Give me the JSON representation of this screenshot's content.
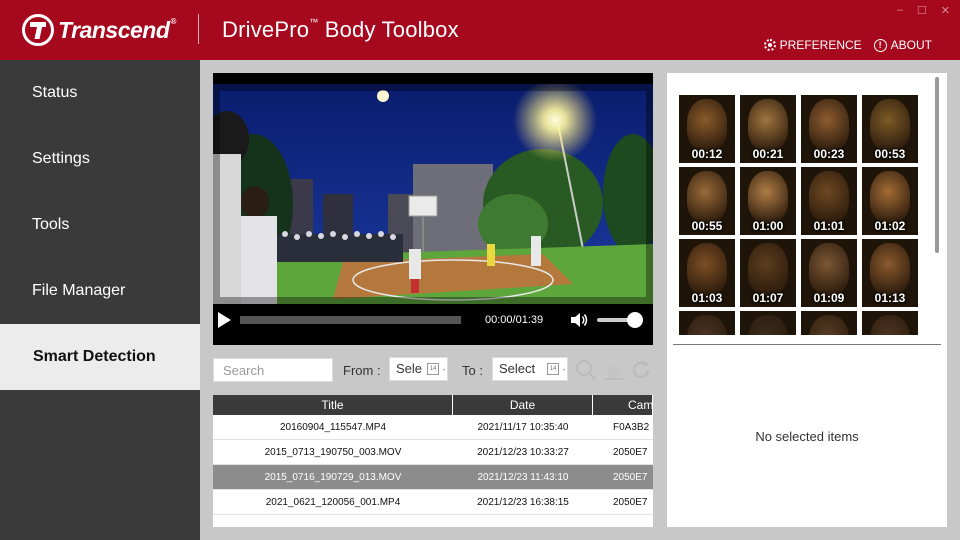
{
  "header": {
    "brand": "Transcend",
    "brand_mark": "®",
    "app_title_a": "DrivePro",
    "app_title_tm": "™",
    "app_title_b": " Body Toolbox",
    "preference": "PREFERENCE",
    "about": "ABOUT",
    "window_controls": [
      "–",
      "☐",
      "✕"
    ]
  },
  "sidebar": {
    "items": [
      {
        "label": "Status",
        "active": false
      },
      {
        "label": "Settings",
        "active": false
      },
      {
        "label": "Tools",
        "active": false
      },
      {
        "label": "File Manager",
        "active": false
      },
      {
        "label": "Smart Detection",
        "active": true
      }
    ]
  },
  "player": {
    "time": "00:00/01:39",
    "progress": 0,
    "volume": 0.8
  },
  "filters": {
    "search_placeholder": "Search",
    "from_label": "From :",
    "from_value": "Sele",
    "to_label": "To :",
    "to_value": "Select"
  },
  "table": {
    "columns": [
      "Title",
      "Date",
      "Cam"
    ],
    "rows": [
      {
        "title": "20160904_115547.MP4",
        "date": "2021/11/17 10:35:40",
        "cam": "F0A3B2",
        "selected": false
      },
      {
        "title": "2015_0713_190750_003.MOV",
        "date": "2021/12/23 10:33:27",
        "cam": "2050E7",
        "selected": false
      },
      {
        "title": "2015_0716_190729_013.MOV",
        "date": "2021/12/23 11:43:10",
        "cam": "2050E7",
        "selected": true
      },
      {
        "title": "2021_0621_120056_001.MP4",
        "date": "2021/12/23 16:38:15",
        "cam": "2050E7",
        "selected": false
      }
    ]
  },
  "faces": {
    "thumbnails": [
      {
        "time": "00:12",
        "color": "#8a5a2a"
      },
      {
        "time": "00:21",
        "color": "#a0743f"
      },
      {
        "time": "00:23",
        "color": "#8e5c30"
      },
      {
        "time": "00:53",
        "color": "#7d5a26"
      },
      {
        "time": "00:55",
        "color": "#9a6a38"
      },
      {
        "time": "01:00",
        "color": "#b07c45"
      },
      {
        "time": "01:01",
        "color": "#6e4822"
      },
      {
        "time": "01:02",
        "color": "#a36b36"
      },
      {
        "time": "01:03",
        "color": "#7e4f24"
      },
      {
        "time": "01:07",
        "color": "#5d3d1e"
      },
      {
        "time": "01:09",
        "color": "#7c5734"
      },
      {
        "time": "01:13",
        "color": "#8a5a2c"
      },
      {
        "time": "",
        "color": "#4a3322"
      },
      {
        "time": "",
        "color": "#3c2a1c"
      },
      {
        "time": "",
        "color": "#5a3c24"
      },
      {
        "time": "",
        "color": "#4e3420"
      }
    ],
    "empty_message": "No selected items"
  }
}
